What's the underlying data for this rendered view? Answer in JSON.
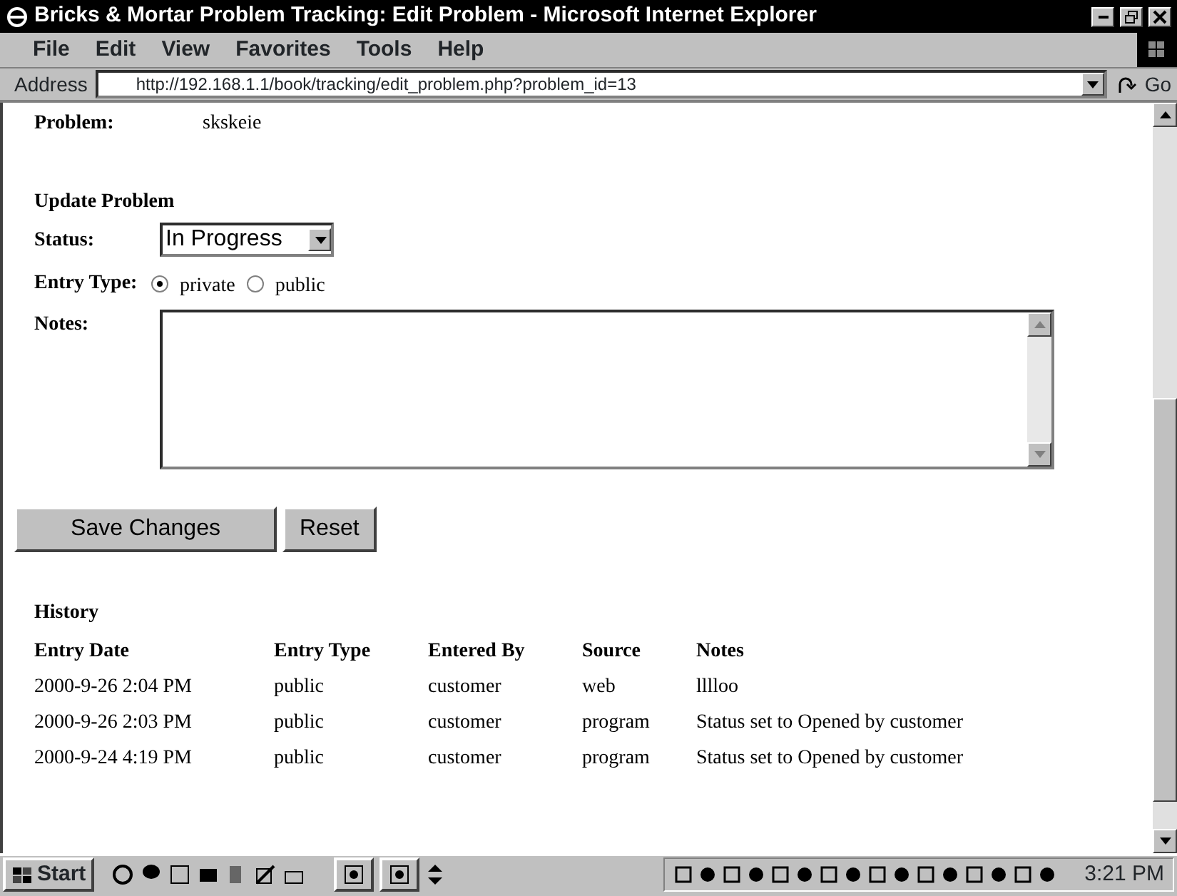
{
  "window": {
    "title": "Bricks & Mortar Problem Tracking: Edit Problem - Microsoft Internet Explorer"
  },
  "menu": [
    "File",
    "Edit",
    "View",
    "Favorites",
    "Tools",
    "Help"
  ],
  "address_bar": {
    "label": "Address",
    "value": "http://192.168.1.1/book/tracking/edit_problem.php?problem_id=13",
    "go": "Go"
  },
  "problem": {
    "label": "Problem:",
    "value": "skskeie"
  },
  "update": {
    "heading": "Update Problem",
    "status_label": "Status:",
    "status_value": "In Progress",
    "entry_type_label": "Entry Type:",
    "entry_types": [
      {
        "label": "private",
        "selected": true
      },
      {
        "label": "public",
        "selected": false
      }
    ],
    "notes_label": "Notes:"
  },
  "buttons": [
    "Save Changes",
    "Reset"
  ],
  "history": {
    "heading": "History",
    "columns": [
      "Entry Date",
      "Entry Type",
      "Entered By",
      "Source",
      "Notes"
    ],
    "rows": [
      [
        "2000-9-26 2:04 PM",
        "public",
        "customer",
        "web",
        "lllloo"
      ],
      [
        "2000-9-26 2:03 PM",
        "public",
        "customer",
        "program",
        "Status set to Opened by customer"
      ],
      [
        "2000-9-24 4:19 PM",
        "public",
        "customer",
        "program",
        "Status set to Opened by customer"
      ]
    ]
  },
  "taskbar": {
    "start": "Start",
    "clock": "3:21 PM"
  }
}
